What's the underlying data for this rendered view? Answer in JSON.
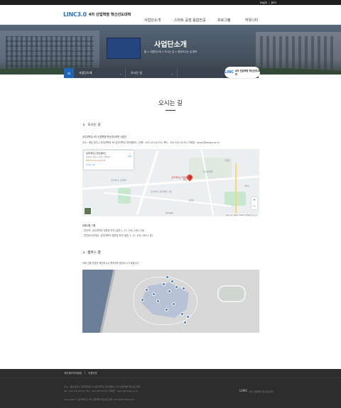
{
  "topbar": {
    "login": "Login",
    "divider": "|",
    "join": "Join"
  },
  "logo": {
    "mark_a": "LINC",
    "mark_b": "3.0",
    "title": "4차 산업혁명 혁신선도대학",
    "subtitle": ""
  },
  "nav": {
    "items": [
      "사업단소개",
      "스마트 공장 융합전공",
      "프로그램",
      "커뮤니티"
    ]
  },
  "hero": {
    "title": "사업단소개",
    "breadcrumb": "홈 > 사업단소개 > 오시는 길 > 찾아오시는 길 정보"
  },
  "subnav": {
    "home_icon": "home-icon",
    "dropdown1": "사업단소개",
    "dropdown2": "오시는 길",
    "badge_mark": "LINC",
    "badge_text": "4차 산업혁명 혁신선도대학"
  },
  "page_title": "오시는 길",
  "section1": {
    "heading": "오시는 길",
    "org": "공주대학교 4차 산업혁명 혁신선도대학 사업단",
    "address": "주소 : 충남 공주시 공주대학로 56 공주대학교 천안캠퍼스 | 전화 : 041-521-9174 | 팩스 : 041-521-9178 | 이메일 : ssyun@kongju.ac.kr"
  },
  "map": {
    "place_name": "공주대학교 천안캠퍼스",
    "place_addr": "충청남도 천안시 서북구 천안대로",
    "rating": "4.4",
    "stars": "★★★★★",
    "reviews": "리뷰 439",
    "larger": "큰 지도 보기",
    "directions": "경로",
    "pin_label": "공주대학교 천안캠퍼스",
    "labels": [
      "공주대학교 공과대학",
      "공주대학교 천안캠퍼스 정문",
      "천안공업대학",
      "두정동",
      "성정동",
      "아파트"
    ],
    "zoom_in": "+",
    "zoom_out": "−",
    "google": "Google",
    "attribution": "단축키 지도 데이터 ©2021 이용약관 오류 신고"
  },
  "transit": {
    "title": "대중교통 이용",
    "line1": "- 천안역 : 공주대학교 정류장 하차 (일반 1, 11, 100, 160-1 등)",
    "line2": "- 천안버스터미널 : 공주대학교 정류장 하차 (일반 1, 11, 100, 160-1 등)"
  },
  "section2": {
    "heading": "캠퍼스 맵",
    "desc": "아래 건물 번호를 확인하시고 목적지를 찾아주시기 바랍니다."
  },
  "footer": {
    "links": [
      "개인정보처리방침",
      "|",
      "이용약관"
    ],
    "info1": "주소 : 충남 공주시 공주대학로 56 공주대학교 천안캠퍼스 4차 산업혁명 혁신선도대학",
    "info2": "Tel : 041-521-9174 | Fax : 041-521-9178 | 이메일 : ssyun@kongju.ac.kr",
    "copyright": "Copyright © 공주대학교 4차 산업혁명 혁신선도대학. All Rights Reserved.",
    "logo_mark": "LINC",
    "logo_text": "4차 산업혁명 혁신선도대학"
  },
  "colors": {
    "accent_blue": "#1e64b7",
    "accent_orange": "#e3722c",
    "footer_bg": "#2d2d2d",
    "subnav_bg": "#3b4350"
  }
}
